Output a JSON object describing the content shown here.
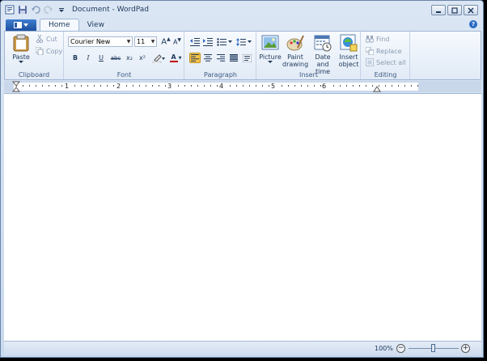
{
  "window": {
    "title": "Document - WordPad"
  },
  "tabs": {
    "home": "Home",
    "view": "View"
  },
  "clipboard": {
    "label": "Clipboard",
    "paste": "Paste",
    "cut": "Cut",
    "copy": "Copy"
  },
  "font": {
    "label": "Font",
    "family": "Courier New",
    "size": "11",
    "bold": "B",
    "italic": "I",
    "underline": "U",
    "strike": "abc",
    "sub": "x₂",
    "sup": "x²",
    "color_glyph": "A"
  },
  "paragraph": {
    "label": "Paragraph"
  },
  "insert": {
    "label": "Insert",
    "picture": "Picture",
    "paint": "Paint drawing",
    "datetime": "Date and time",
    "object": "Insert object"
  },
  "editing": {
    "label": "Editing",
    "find": "Find",
    "replace": "Replace",
    "select_all": "Select all"
  },
  "ruler": {
    "numbers": [
      "1",
      "2",
      "3",
      "4",
      "5",
      "6"
    ]
  },
  "status": {
    "zoom": "100%",
    "zoom_level": 1.0
  },
  "colors": {
    "accent": "#2a6ac4",
    "ribbon_bg": "#e1eaf6",
    "frame": "#c9d9ee",
    "highlight": "#f4c34a"
  }
}
